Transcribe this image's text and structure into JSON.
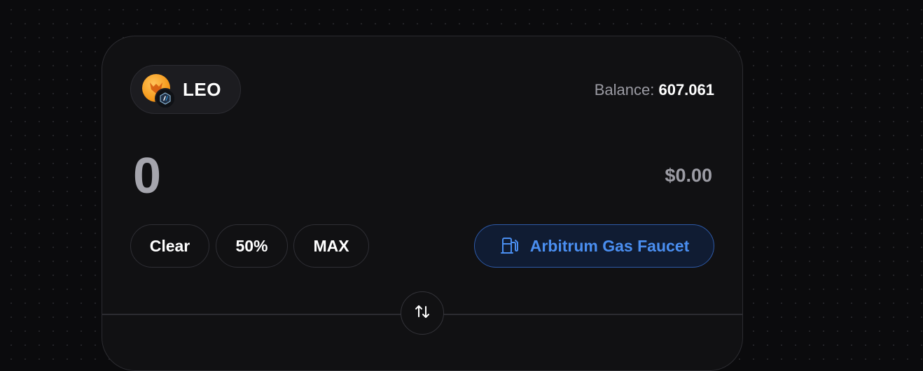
{
  "token": {
    "symbol": "LEO",
    "icon": "leo-token-icon",
    "chain_icon": "arbitrum-chain-icon"
  },
  "balance": {
    "label": "Balance:",
    "value": "607.061"
  },
  "amount": {
    "value": "0",
    "usd_value": "$0.00"
  },
  "quick_actions": {
    "clear_label": "Clear",
    "half_label": "50%",
    "max_label": "MAX"
  },
  "faucet": {
    "label": "Arbitrum Gas Faucet",
    "icon": "gas-pump-icon"
  },
  "swap": {
    "icon": "swap-arrows-icon"
  },
  "colors": {
    "background": "#0b0b0d",
    "card": "#111113",
    "accent_blue": "#4a8ef0",
    "token_orange": "#f59a1c",
    "muted_text": "#9b9ba3"
  }
}
